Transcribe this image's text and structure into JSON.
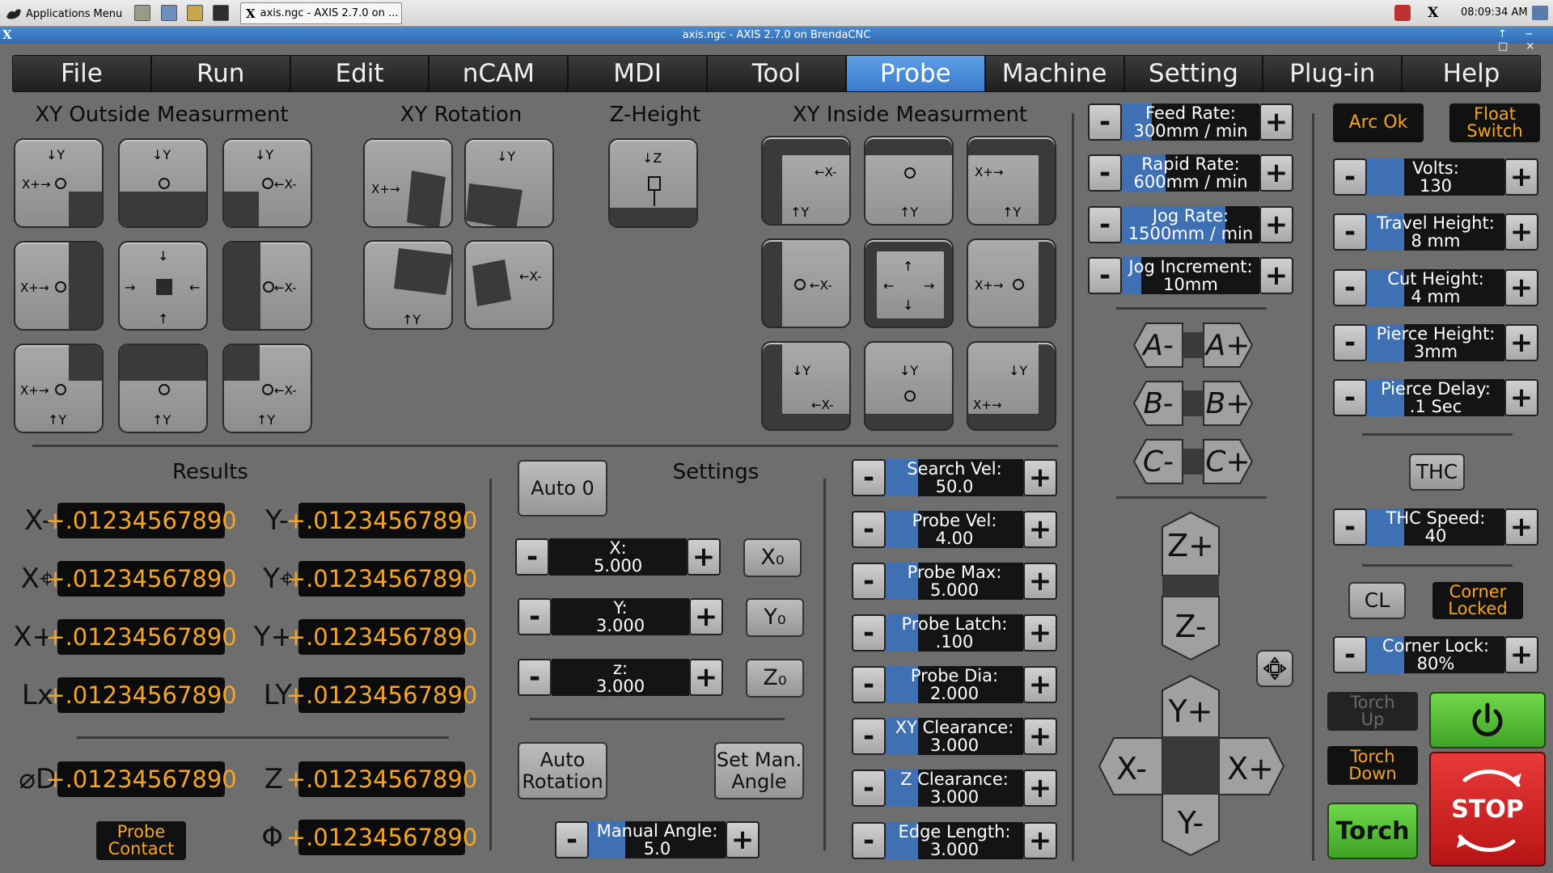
{
  "taskbar": {
    "apps_menu": "Applications Menu",
    "window_tab": "axis.ngc - AXIS 2.7.0 on ...",
    "clock": "08:09:34 AM"
  },
  "window": {
    "title": "axis.ngc - AXIS 2.7.0 on BrendaCNC",
    "x_glyph": "X"
  },
  "menu": {
    "items": [
      "File",
      "Run",
      "Edit",
      "nCAM",
      "MDI",
      "Tool",
      "Probe",
      "Machine",
      "Setting",
      "Plug-in",
      "Help"
    ],
    "active": "Probe"
  },
  "sections": {
    "xy_outside": "XY Outside Measurment",
    "xy_rotation": "XY Rotation",
    "z_height": "Z-Height",
    "xy_inside": "XY Inside Measurment",
    "results": "Results",
    "settings": "Settings"
  },
  "results": {
    "rows": [
      {
        "l_label": "X-",
        "l_value": "+.01234567890",
        "r_label": "Y-",
        "r_value": "+.01234567890"
      },
      {
        "l_label": "X⌖",
        "l_value": "+.01234567890",
        "r_label": "Y⌖",
        "r_value": "+.01234567890"
      },
      {
        "l_label": "X+",
        "l_value": "+.01234567890",
        "r_label": "Y+",
        "r_value": "+.01234567890"
      },
      {
        "l_label": "Lx",
        "l_value": "+.01234567890",
        "r_label": "LY",
        "r_value": "+.01234567890"
      }
    ],
    "d_label": "⌀D",
    "d_value": "+.01234567890",
    "z_label": "Z",
    "z_value": "+.01234567890",
    "phi_label": "Φ",
    "phi_value": "+.01234567890",
    "probe_contact": "Probe\nContact"
  },
  "settings": {
    "auto0": "Auto 0",
    "auto_rotation": "Auto\nRotation",
    "set_man_angle": "Set Man.\nAngle",
    "x": {
      "label": "X:",
      "value": "5.000"
    },
    "y": {
      "label": "Y:",
      "value": "3.000"
    },
    "z": {
      "label": "z:",
      "value": "3.000"
    },
    "x0": "X₀",
    "y0": "Y₀",
    "z0": "Z₀",
    "manual_angle": {
      "label": "Manual Angle:",
      "value": "5.0"
    }
  },
  "probe_params": [
    {
      "label": "Search Vel:",
      "value": "50.0"
    },
    {
      "label": "Probe Vel:",
      "value": "4.00"
    },
    {
      "label": "Probe Max:",
      "value": "5.000"
    },
    {
      "label": "Probe Latch:",
      "value": ".100"
    },
    {
      "label": "Probe Dia:",
      "value": "2.000"
    },
    {
      "label": "XY Clearance:",
      "value": "3.000"
    },
    {
      "label": "Z Clearance:",
      "value": "3.000"
    },
    {
      "label": "Edge Length:",
      "value": "3.000"
    }
  ],
  "jog": {
    "rates": [
      {
        "label": "Feed Rate:",
        "value": "300mm / min"
      },
      {
        "label": "Rapid Rate:",
        "value": "600mm / min"
      },
      {
        "label": "Jog Rate:",
        "value": "1500mm / min"
      },
      {
        "label": "Jog Increment:",
        "value": "10mm"
      }
    ],
    "a_minus": "A-",
    "a_plus": "A+",
    "b_minus": "B-",
    "b_plus": "B+",
    "c_minus": "C-",
    "c_plus": "C+",
    "z_plus": "Z+",
    "z_minus": "Z-",
    "y_plus": "Y+",
    "y_minus": "Y-",
    "x_minus": "X-",
    "x_plus": "X+"
  },
  "plasma": {
    "arc_ok": "Arc Ok",
    "float_switch": "Float\nSwitch",
    "params": [
      {
        "label": "Volts:",
        "value": "130"
      },
      {
        "label": "Travel Height:",
        "value": "8 mm"
      },
      {
        "label": "Cut Height:",
        "value": "4 mm"
      },
      {
        "label": "Pierce Height:",
        "value": "3mm"
      },
      {
        "label": "Pierce Delay:",
        "value": ".1 Sec"
      }
    ],
    "thc": "THC",
    "thc_speed": {
      "label": "THC Speed:",
      "value": "40"
    },
    "cl": "CL",
    "corner_locked": "Corner\nLocked",
    "corner_lock": {
      "label": "Corner Lock:",
      "value": "80%"
    },
    "torch_up": "Torch\nUp",
    "torch_down": "Torch\nDown",
    "torch": "Torch",
    "stop": "STOP"
  },
  "colors": {
    "accent": "#4a8bd8",
    "indicator": "#f4a623",
    "power_green": "#4db832",
    "stop_red": "#d82020"
  },
  "icons": [
    "apps-menu-icon",
    "power-icon",
    "stop-icon",
    "jog-center-icon"
  ]
}
